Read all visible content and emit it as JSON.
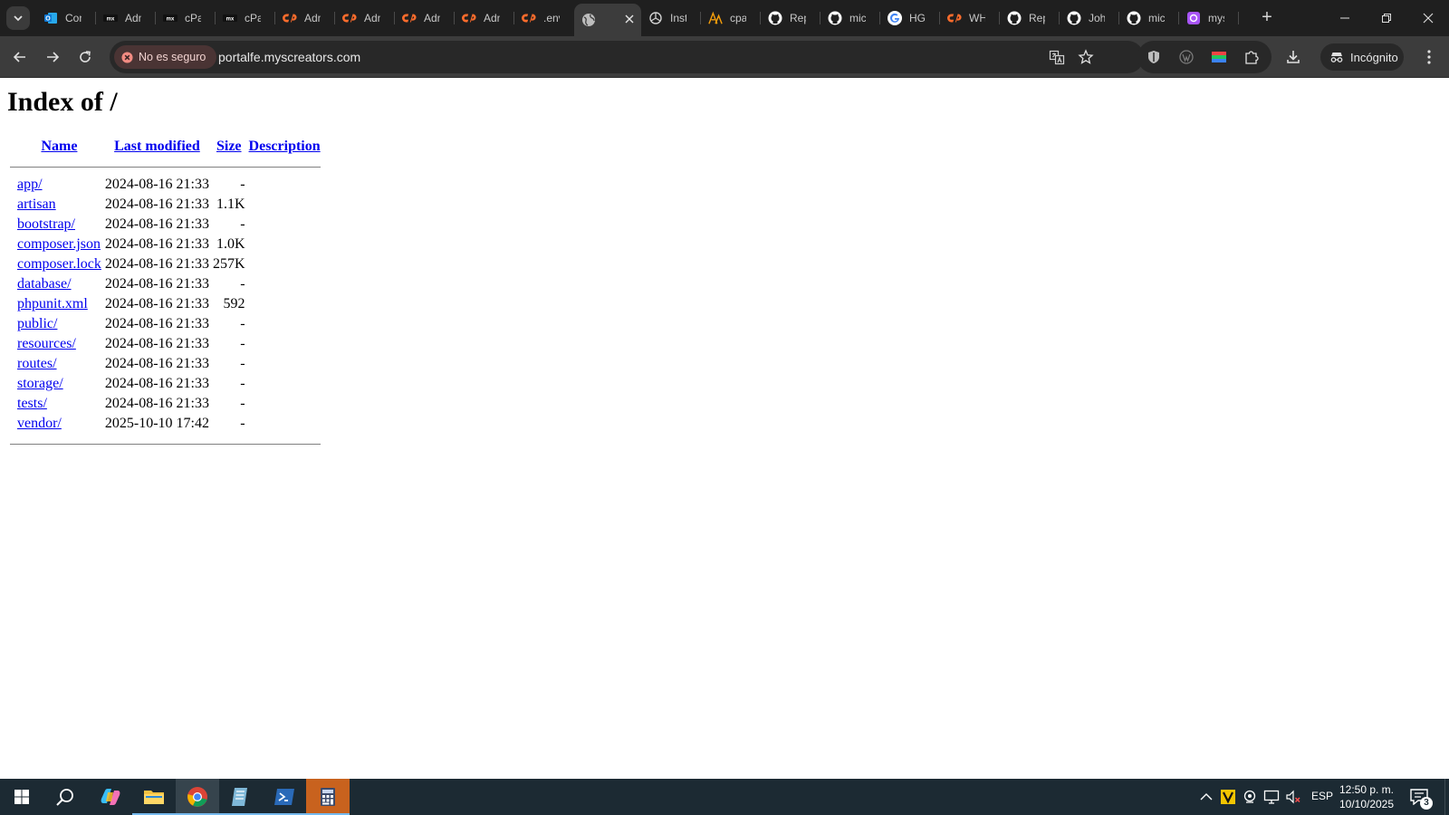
{
  "tabs": [
    {
      "label": "Con",
      "icon": "outlook-icon",
      "color": "#0f78d4"
    },
    {
      "label": "Adn",
      "icon": "mx-logo-icon",
      "color": "#ffffff"
    },
    {
      "label": "cPa",
      "icon": "mx-logo-icon",
      "color": "#ffffff"
    },
    {
      "label": "cPa",
      "icon": "mx-logo-icon",
      "color": "#ffffff"
    },
    {
      "label": "Adn",
      "icon": "cpanel-icon",
      "color": "#ff6c2c"
    },
    {
      "label": "Adn",
      "icon": "cpanel-icon",
      "color": "#ff6c2c"
    },
    {
      "label": "Adn",
      "icon": "cpanel-icon",
      "color": "#ff6c2c"
    },
    {
      "label": "Adn",
      "icon": "cpanel-icon",
      "color": "#ff6c2c"
    },
    {
      "label": ".env",
      "icon": "cpanel-icon",
      "color": "#ff6c2c"
    },
    {
      "label": "",
      "icon": "globe-icon",
      "color": "#bdbdbd",
      "active": true
    },
    {
      "label": "Inst",
      "icon": "openai-icon",
      "color": "#d0d0d0"
    },
    {
      "label": "cpa",
      "icon": "ai-logo-icon",
      "color": "#f59e0b"
    },
    {
      "label": "Rep",
      "icon": "github-icon",
      "color": "#ffffff"
    },
    {
      "label": "mic",
      "icon": "github-icon",
      "color": "#ffffff"
    },
    {
      "label": "HGI",
      "icon": "google-icon",
      "color": "#4285f4"
    },
    {
      "label": "WH",
      "icon": "cpanel-icon",
      "color": "#ff6c2c"
    },
    {
      "label": "Rep",
      "icon": "github-icon",
      "color": "#ffffff"
    },
    {
      "label": "Joh",
      "icon": "github-icon",
      "color": "#ffffff"
    },
    {
      "label": "mic",
      "icon": "github-icon",
      "color": "#ffffff"
    },
    {
      "label": "mys",
      "icon": "app-icon",
      "color": "#a855f7"
    }
  ],
  "toolbar": {
    "security_label": "No es seguro",
    "url": "portalfe.myscreators.com",
    "incognito_label": "Incógnito"
  },
  "page": {
    "title": "Index of /",
    "columns": [
      "Name",
      "Last modified",
      "Size",
      "Description"
    ],
    "rows": [
      {
        "name": "app/",
        "modified": "2024-08-16 21:33",
        "size": "-",
        "description": ""
      },
      {
        "name": "artisan",
        "modified": "2024-08-16 21:33",
        "size": "1.1K",
        "description": ""
      },
      {
        "name": "bootstrap/",
        "modified": "2024-08-16 21:33",
        "size": "-",
        "description": ""
      },
      {
        "name": "composer.json",
        "modified": "2024-08-16 21:33",
        "size": "1.0K",
        "description": ""
      },
      {
        "name": "composer.lock",
        "modified": "2024-08-16 21:33",
        "size": "257K",
        "description": ""
      },
      {
        "name": "database/",
        "modified": "2024-08-16 21:33",
        "size": "-",
        "description": ""
      },
      {
        "name": "phpunit.xml",
        "modified": "2024-08-16 21:33",
        "size": "592",
        "description": ""
      },
      {
        "name": "public/",
        "modified": "2024-08-16 21:33",
        "size": "-",
        "description": ""
      },
      {
        "name": "resources/",
        "modified": "2024-08-16 21:33",
        "size": "-",
        "description": ""
      },
      {
        "name": "routes/",
        "modified": "2024-08-16 21:33",
        "size": "-",
        "description": ""
      },
      {
        "name": "storage/",
        "modified": "2024-08-16 21:33",
        "size": "-",
        "description": ""
      },
      {
        "name": "tests/",
        "modified": "2024-08-16 21:33",
        "size": "-",
        "description": ""
      },
      {
        "name": "vendor/",
        "modified": "2025-10-10 17:42",
        "size": "-",
        "description": ""
      }
    ]
  },
  "taskbar": {
    "language": "ESP",
    "time": "12:50 p. m.",
    "date": "10/10/2025",
    "notifications": "3"
  }
}
